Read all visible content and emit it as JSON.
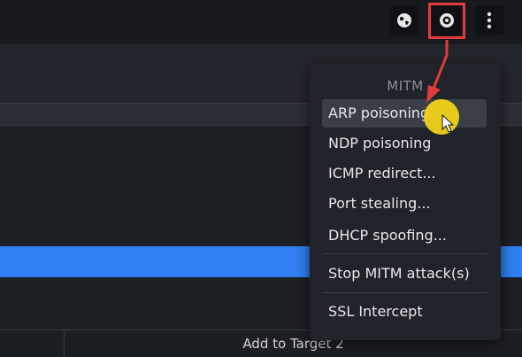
{
  "menu": {
    "title": "MITM",
    "items": [
      {
        "label": "ARP poisoning..."
      },
      {
        "label": "NDP poisoning"
      },
      {
        "label": "ICMP redirect..."
      },
      {
        "label": "Port stealing..."
      },
      {
        "label": "DHCP spoofing..."
      },
      {
        "label": "Stop MITM attack(s)"
      },
      {
        "label": "SSL Intercept"
      }
    ]
  },
  "bottom": {
    "add_target_label": "Add to Target 2"
  },
  "toolbar": {
    "icons": [
      "globe-icon",
      "mitm-icon",
      "more-vert-icon"
    ]
  },
  "colors": {
    "highlight_box": "#e23b3b",
    "arrow": "#e23b3b",
    "selected_row": "#2f7ff0",
    "cursor_highlight": "#f0d21a"
  }
}
